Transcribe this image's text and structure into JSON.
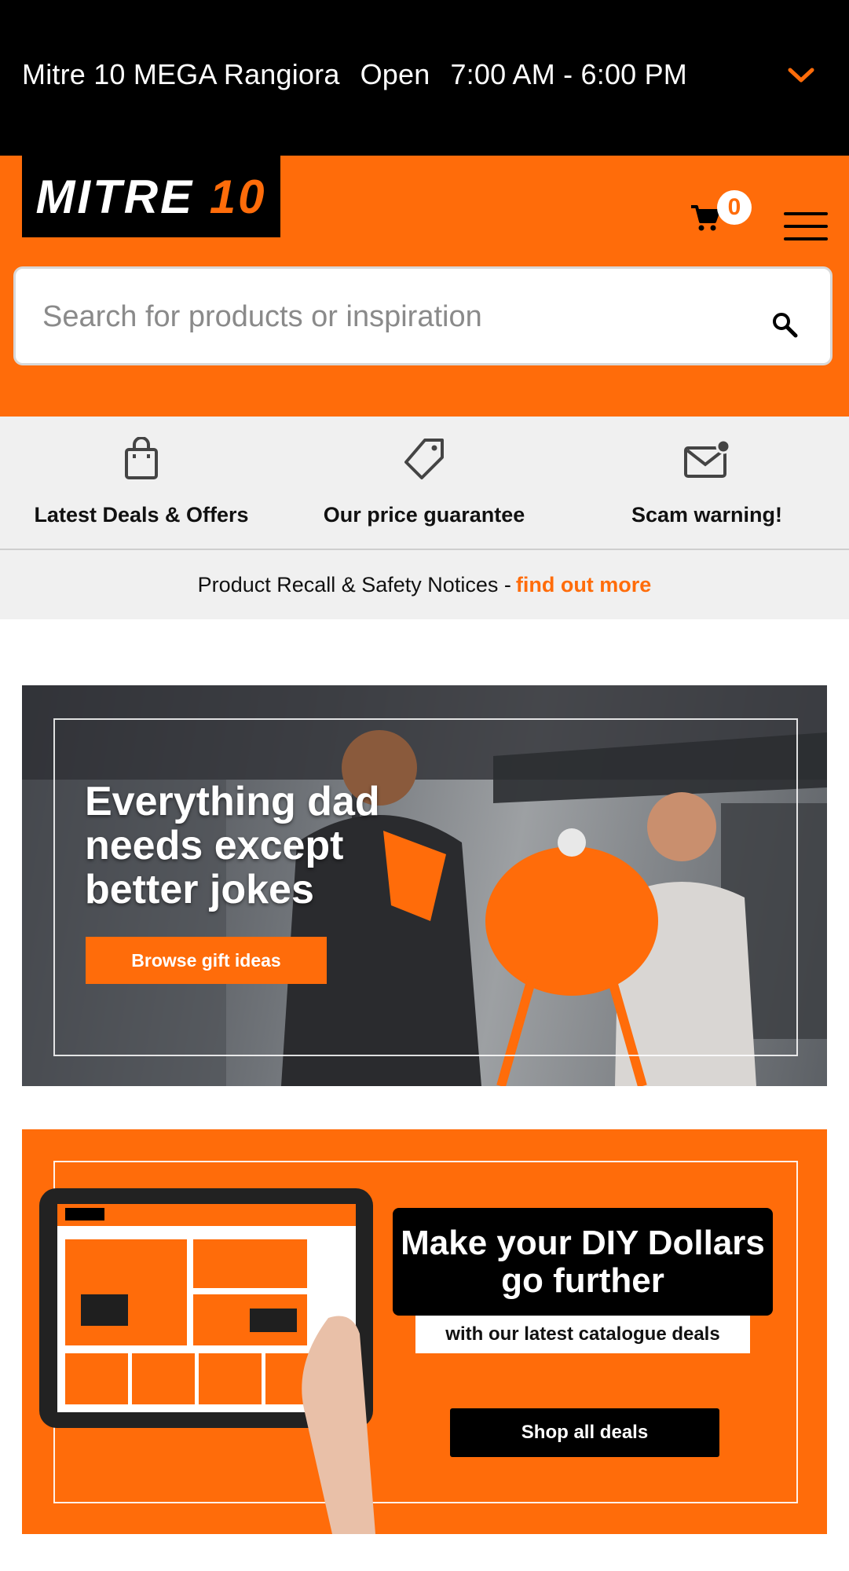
{
  "store_bar": {
    "store_name": "Mitre 10 MEGA Rangiora",
    "status": "Open",
    "hours": "7:00 AM - 6:00 PM",
    "chevron_icon": "chevron-down-icon"
  },
  "header": {
    "logo_main": "MITRE ",
    "logo_accent": "10",
    "cart_count": "0",
    "cart_icon": "cart-icon",
    "menu_icon": "hamburger-menu-icon"
  },
  "search": {
    "placeholder": "Search for products or inspiration",
    "icon": "search-icon"
  },
  "quick_links": [
    {
      "label": "Latest Deals & Offers",
      "icon": "shopping-bag-icon"
    },
    {
      "label": "Our price guarantee",
      "icon": "price-tag-icon"
    },
    {
      "label": "Scam warning!",
      "icon": "mail-alert-icon"
    }
  ],
  "recall": {
    "text": "Product Recall & Safety Notices -",
    "link": "find out more"
  },
  "banner_gifts": {
    "headline": "Everything dad needs except better jokes",
    "button": "Browse gift ideas"
  },
  "banner_catalogue": {
    "headline": "Make your DIY Dollars go further",
    "subline": "with our latest catalogue deals",
    "button": "Shop all deals"
  },
  "colors": {
    "brand_orange": "#ff6c0a",
    "black": "#000000",
    "light_grey": "#f0f0f0"
  }
}
